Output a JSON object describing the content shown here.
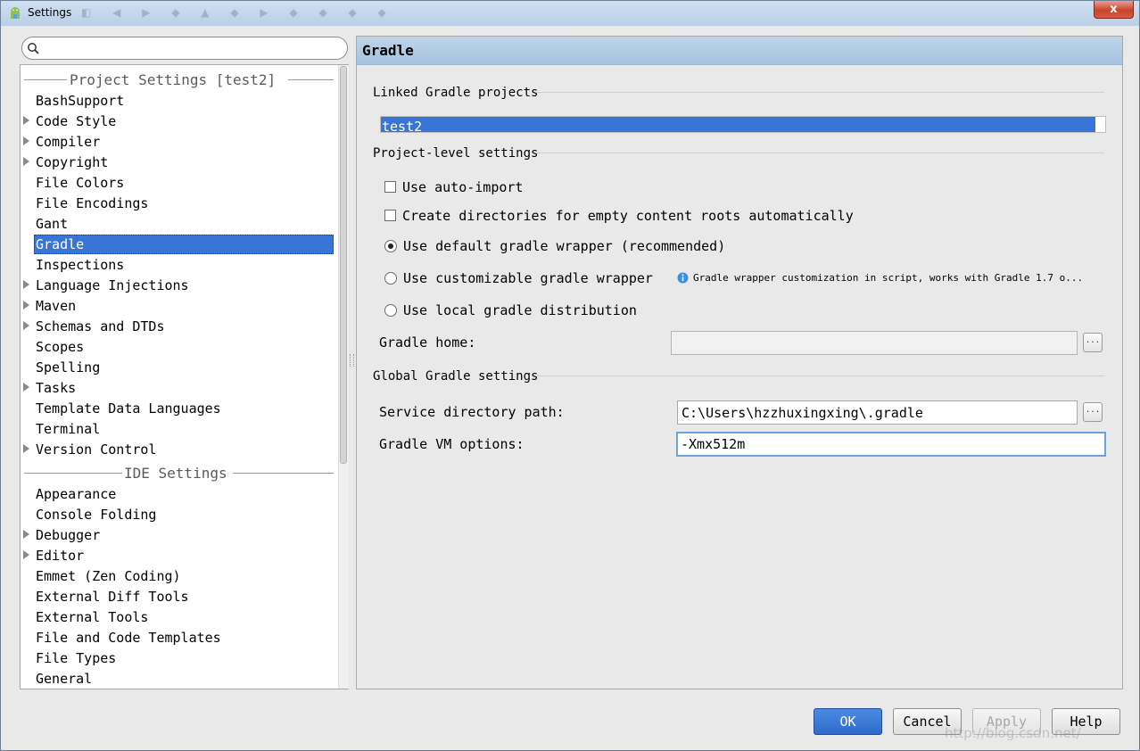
{
  "window": {
    "title": "Settings",
    "close_label": "x"
  },
  "search": {
    "placeholder": "",
    "value": ""
  },
  "tree": {
    "project_group": "Project Settings [test2]",
    "project_items": [
      {
        "label": "BashSupport",
        "expandable": false
      },
      {
        "label": "Code Style",
        "expandable": true
      },
      {
        "label": "Compiler",
        "expandable": true
      },
      {
        "label": "Copyright",
        "expandable": true
      },
      {
        "label": "File Colors",
        "expandable": false
      },
      {
        "label": "File Encodings",
        "expandable": false
      },
      {
        "label": "Gant",
        "expandable": false
      },
      {
        "label": "Gradle",
        "expandable": false,
        "selected": true
      },
      {
        "label": "Inspections",
        "expandable": false
      },
      {
        "label": "Language Injections",
        "expandable": true
      },
      {
        "label": "Maven",
        "expandable": true
      },
      {
        "label": "Schemas and DTDs",
        "expandable": true
      },
      {
        "label": "Scopes",
        "expandable": false
      },
      {
        "label": "Spelling",
        "expandable": false
      },
      {
        "label": "Tasks",
        "expandable": true
      },
      {
        "label": "Template Data Languages",
        "expandable": false
      },
      {
        "label": "Terminal",
        "expandable": false
      },
      {
        "label": "Version Control",
        "expandable": true
      }
    ],
    "ide_group": "IDE Settings",
    "ide_items": [
      {
        "label": "Appearance",
        "expandable": false
      },
      {
        "label": "Console Folding",
        "expandable": false
      },
      {
        "label": "Debugger",
        "expandable": true
      },
      {
        "label": "Editor",
        "expandable": true
      },
      {
        "label": "Emmet (Zen Coding)",
        "expandable": false
      },
      {
        "label": "External Diff Tools",
        "expandable": false
      },
      {
        "label": "External Tools",
        "expandable": false
      },
      {
        "label": "File and Code Templates",
        "expandable": false
      },
      {
        "label": "File Types",
        "expandable": false
      },
      {
        "label": "General",
        "expandable": false
      }
    ]
  },
  "gradle": {
    "title": "Gradle",
    "linked_section": "Linked Gradle projects",
    "linked_projects": [
      "test2"
    ],
    "project_section": "Project-level settings",
    "auto_import_label": "Use auto-import",
    "auto_import_checked": false,
    "create_dirs_label": "Create directories for empty content roots automatically",
    "create_dirs_checked": false,
    "wrapper_options": [
      "Use default gradle wrapper (recommended)",
      "Use customizable gradle wrapper",
      "Use local gradle distribution"
    ],
    "selected_wrapper": "Use default gradle wrapper (recommended)",
    "wrapper_hint": "Gradle wrapper customization in script, works with Gradle 1.7 o...",
    "gradle_home_label": "Gradle home:",
    "gradle_home_value": "",
    "global_section": "Global Gradle settings",
    "service_dir_label": "Service directory path:",
    "service_dir_value": "C:\\Users\\hzzhuxingxing\\.gradle",
    "vm_options_label": "Gradle VM options:",
    "vm_options_value": "-Xmx512m",
    "browse_label": "..."
  },
  "buttons": {
    "ok": "OK",
    "cancel": "Cancel",
    "apply": "Apply",
    "help": "Help"
  },
  "watermark": "http://blog.csdn.net/",
  "colors": {
    "selection": "#3875d7",
    "header": "#bed4ea",
    "primary_button": "#2e6ccd"
  }
}
